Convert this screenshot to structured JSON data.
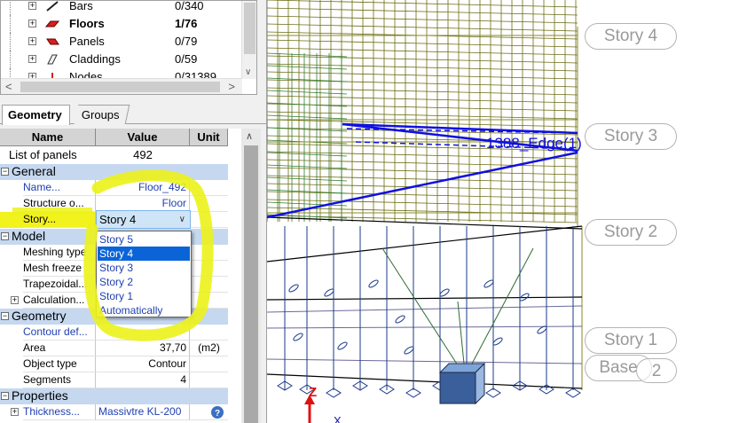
{
  "tree": {
    "items": [
      {
        "label": "Bars",
        "count": "0/340",
        "bold": false,
        "icon": "bar-icon"
      },
      {
        "label": "Floors",
        "count": "1/76",
        "bold": true,
        "icon": "floor-icon"
      },
      {
        "label": "Panels",
        "count": "0/79",
        "bold": false,
        "icon": "panel-icon"
      },
      {
        "label": "Claddings",
        "count": "0/59",
        "bold": false,
        "icon": "cladding-icon"
      },
      {
        "label": "Nodes",
        "count": "0/31389",
        "bold": false,
        "icon": "node-icon"
      }
    ]
  },
  "tabs": [
    {
      "label": "Geometry",
      "active": true
    },
    {
      "label": "Groups",
      "active": false
    }
  ],
  "props": {
    "headers": {
      "name": "Name",
      "value": "Value",
      "unit": "Unit"
    },
    "list_label": "List of panels",
    "list_value": "492",
    "sections": {
      "general": "General",
      "model": "Model",
      "geometry": "Geometry",
      "properties": "Properties"
    },
    "general_rows": [
      {
        "name": "Name...",
        "value": "Floor_492",
        "unit": ""
      },
      {
        "name": "Structure o...",
        "value": "Floor",
        "unit": ""
      },
      {
        "name": "Story...",
        "value": "",
        "unit": ""
      }
    ],
    "model_rows": [
      {
        "name": "Meshing type",
        "value": "",
        "unit": ""
      },
      {
        "name": "Mesh freeze",
        "value": "",
        "unit": ""
      },
      {
        "name": "Trapezoidal...",
        "value": "",
        "unit": ""
      },
      {
        "name": "Calculation...",
        "value": "",
        "unit": ""
      }
    ],
    "geometry_rows": [
      {
        "name": "Contour def...",
        "value": "",
        "unit": ""
      },
      {
        "name": "Area",
        "value": "37,70",
        "unit": "(m2)"
      },
      {
        "name": "Object type",
        "value": "Contour",
        "unit": ""
      },
      {
        "name": "Segments",
        "value": "4",
        "unit": ""
      }
    ],
    "properties_rows": [
      {
        "name": "Thickness...",
        "value": "Massivtre KL-200",
        "unit": ""
      }
    ]
  },
  "story_select": {
    "selected": "Story 4",
    "options": [
      "Story 5",
      "Story 4",
      "Story 3",
      "Story 2",
      "Story 1",
      "Automatically"
    ]
  },
  "viewport": {
    "story_tags": [
      "Story 4",
      "Story 3",
      "Story 2",
      "Story 1",
      "Base"
    ],
    "base_index": "2",
    "edge_label": "1388_Edge(1)",
    "axis_z": "Z",
    "axis_x": "X"
  },
  "colors": {
    "section_bg": "#c5d8f0",
    "selection": "#0a64d8",
    "link_text": "#1f3fb0",
    "highlight_yellow": "#f2f21c",
    "mesh_olive": "#6b6b10",
    "mesh_green": "#2e7d2e",
    "edge_blue": "#1010e0",
    "support_box": "#4a6fa5"
  }
}
